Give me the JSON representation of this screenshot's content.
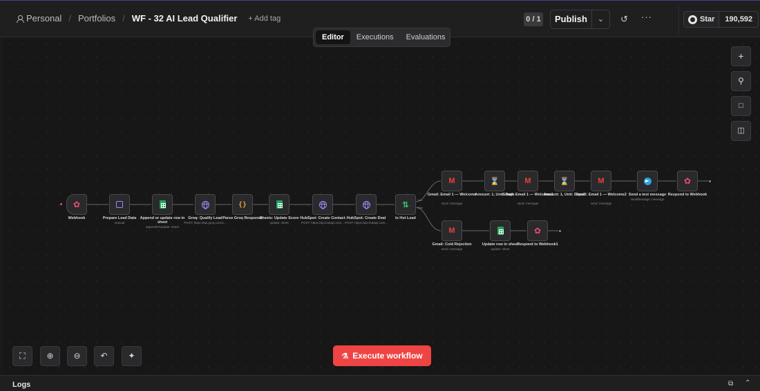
{
  "header": {
    "breadcrumbs": [
      "Personal",
      "Portfolios"
    ],
    "workflow_title": "WF - 32 AI Lead Qualifier",
    "add_tag_label": "+ Add tag",
    "version_counter": "0 / 1",
    "publish_label": "Publish",
    "github_star_label": "Star",
    "github_star_count": "190,592"
  },
  "tabs": [
    "Editor",
    "Executions",
    "Evaluations"
  ],
  "active_tab": "Editor",
  "nodes": [
    {
      "key": "webhook",
      "title": "Webhook",
      "subtitle": "",
      "icon": "webhook-icon"
    },
    {
      "key": "prepare",
      "title": "Prepare Lead Data",
      "subtitle": "manual",
      "icon": "edit-icon"
    },
    {
      "key": "append",
      "title": "Append or update row in sheet",
      "subtitle": "appendOrUpdate: sheet",
      "icon": "google-sheets-icon"
    },
    {
      "key": "groq",
      "title": "Groq: Qualify Lead",
      "subtitle": "POST: https://api.groq.com/o...",
      "icon": "http-globe-icon"
    },
    {
      "key": "parse",
      "title": "Parse Groq Response",
      "subtitle": "",
      "icon": "code-braces-icon"
    },
    {
      "key": "sheets_score",
      "title": "Sheets: Update Score",
      "subtitle": "update: sheet",
      "icon": "google-sheets-icon"
    },
    {
      "key": "hs_contact",
      "title": "HubSpot: Create Contact",
      "subtitle": "POST: https://api.hubapi.com...",
      "icon": "http-globe-icon"
    },
    {
      "key": "hs_deal",
      "title": "HubSpot: Create Deal",
      "subtitle": "POST: https://api.hubapi.com...",
      "icon": "http-globe-icon"
    },
    {
      "key": "if_hot",
      "title": "Is Hot Lead",
      "subtitle": "",
      "icon": "if-branch-icon"
    },
    {
      "key": "gmail1",
      "title": "Gmail: Email 1 — Welcome",
      "subtitle": "send: message",
      "icon": "gmail-icon"
    },
    {
      "key": "wait1",
      "title": "Amount: 1, Unit: Days",
      "subtitle": "",
      "icon": "hourglass-icon"
    },
    {
      "key": "gmail2",
      "title": "Gmail: Email 1 — Welcome1",
      "subtitle": "send: message",
      "icon": "gmail-icon"
    },
    {
      "key": "wait2",
      "title": "Amount: 1, Unit: Days1",
      "subtitle": "",
      "icon": "hourglass-icon"
    },
    {
      "key": "gmail3",
      "title": "Gmail: Email 1 — Welcome2",
      "subtitle": "send: message",
      "icon": "gmail-icon"
    },
    {
      "key": "telegram",
      "title": "Send a text message",
      "subtitle": "sendMessage: message",
      "icon": "telegram-icon"
    },
    {
      "key": "respond1",
      "title": "Respond to Webhook",
      "subtitle": "",
      "icon": "webhook-icon"
    },
    {
      "key": "gmail_cold",
      "title": "Gmail: Cold Rejection",
      "subtitle": "send: message",
      "icon": "gmail-icon"
    },
    {
      "key": "update_row",
      "title": "Update row in sheet",
      "subtitle": "update: sheet",
      "icon": "google-sheets-icon"
    },
    {
      "key": "respond2",
      "title": "Respond to Webhook1",
      "subtitle": "",
      "icon": "webhook-icon"
    }
  ],
  "branch_labels": {
    "true": "true",
    "false": "false"
  },
  "execute_label": "Execute workflow",
  "logs_label": "Logs",
  "colors": {
    "execute": "#ef4444",
    "webhook": "#ea4b71",
    "sheets": "#22a35b",
    "http": "#9b8cf5"
  }
}
